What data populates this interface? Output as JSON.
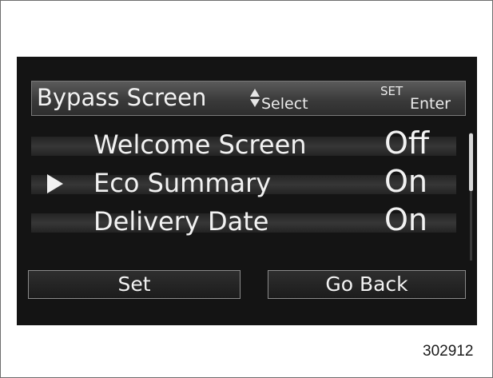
{
  "header": {
    "title": "Bypass Screen",
    "select_hint": "Select",
    "set_hint": "SET",
    "enter_hint": "Enter"
  },
  "settings": [
    {
      "label": "Welcome Screen",
      "value": "Off",
      "selected": false
    },
    {
      "label": "Eco Summary",
      "value": "On",
      "selected": true
    },
    {
      "label": "Delivery Date",
      "value": "On",
      "selected": false
    }
  ],
  "icons": {
    "selection_cursor": "triangle-right-icon",
    "select_arrows": "up-down-arrows-icon"
  },
  "buttons": {
    "set_label": "Set",
    "back_label": "Go Back"
  },
  "figure_number": "302912"
}
